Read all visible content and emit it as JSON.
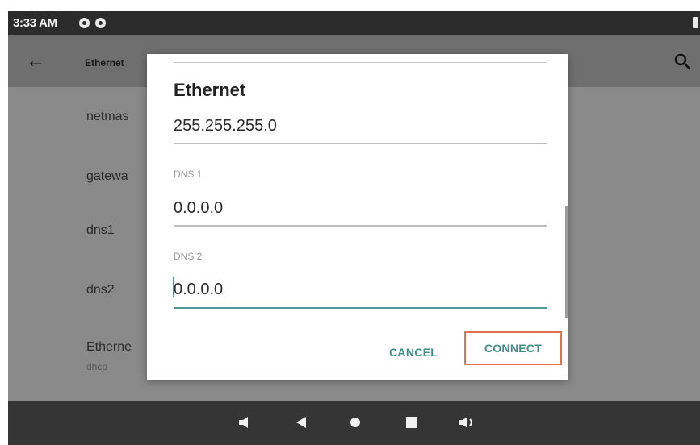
{
  "status_bar": {
    "time": "3:33 AM"
  },
  "app_bar": {
    "title": "Ethernet"
  },
  "background_list": {
    "items": [
      {
        "label": "netmas"
      },
      {
        "label": "gatewa"
      },
      {
        "label": "dns1"
      },
      {
        "label": "dns2"
      },
      {
        "label": "Etherne",
        "sub": "dhcp"
      }
    ]
  },
  "dialog": {
    "title": "Ethernet",
    "netmask_value": "255.255.255.0",
    "dns1": {
      "label": "DNS 1",
      "value": "0.0.0.0"
    },
    "dns2": {
      "label": "DNS 2",
      "value": "0.0.0.0"
    },
    "cancel_label": "CANCEL",
    "connect_label": "CONNECT"
  },
  "colors": {
    "accent": "#3d8f8a",
    "highlight_border": "#e07050"
  },
  "icons": [
    "status-app-icon",
    "battery-icon",
    "back-arrow-icon",
    "search-icon",
    "volume-down-icon",
    "back-icon",
    "home-icon",
    "recents-icon",
    "volume-up-icon"
  ]
}
